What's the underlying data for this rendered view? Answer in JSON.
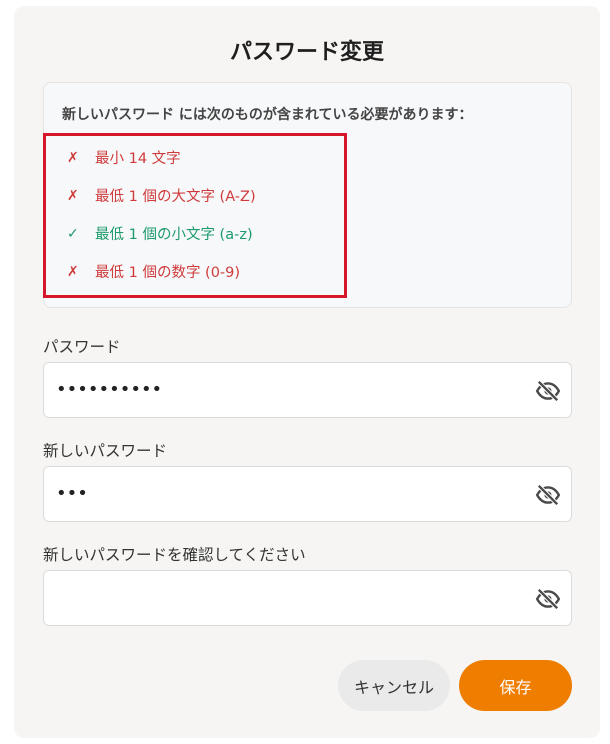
{
  "dialog": {
    "title": "パスワード変更"
  },
  "requirements": {
    "heading": "新しいパスワード には次のものが含まれている必要があります：",
    "items": [
      {
        "mark": "✗",
        "label": "最小 14 文字",
        "status": "fail"
      },
      {
        "mark": "✗",
        "label": "最低 1 個の大文字 (A-Z)",
        "status": "fail"
      },
      {
        "mark": "✓",
        "label": "最低 1 個の小文字 (a-z)",
        "status": "ok"
      },
      {
        "mark": "✗",
        "label": "最低 1 個の数字 (0-9)",
        "status": "fail"
      }
    ]
  },
  "fields": {
    "current": {
      "label": "パスワード",
      "value": "••••••••••"
    },
    "new": {
      "label": "新しいパスワード",
      "value": "•••"
    },
    "confirm": {
      "label": "新しいパスワードを確認してください",
      "value": ""
    }
  },
  "icons": {
    "visibility": "eye-off-icon"
  },
  "buttons": {
    "cancel": "キャンセル",
    "save": "保存"
  },
  "colors": {
    "accent": "#ee7d00",
    "fail": "#cf3b3b",
    "ok": "#1d9a6c",
    "highlight": "#d6162a"
  }
}
